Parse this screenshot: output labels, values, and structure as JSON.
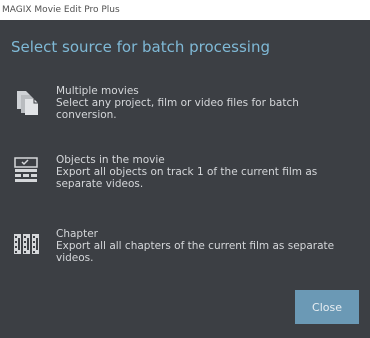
{
  "window": {
    "title": "MAGIX Movie Edit Pro Plus"
  },
  "dialog": {
    "heading": "Select source for batch processing",
    "options": [
      {
        "icon": "multiple-files-icon",
        "title": "Multiple movies",
        "description": "Select any project, film or video files for batch conversion."
      },
      {
        "icon": "objects-track-icon",
        "title": "Objects in the movie",
        "description": "Export all objects on track 1 of the current film as separate videos."
      },
      {
        "icon": "chapters-film-icon",
        "title": "Chapter",
        "description": "Export all all chapters of the current film as separate videos."
      }
    ],
    "close_label": "Close"
  },
  "colors": {
    "background": "#3c3f44",
    "accent": "#7fb9d6",
    "button": "#6b99b5",
    "text": "#d5d7da"
  }
}
